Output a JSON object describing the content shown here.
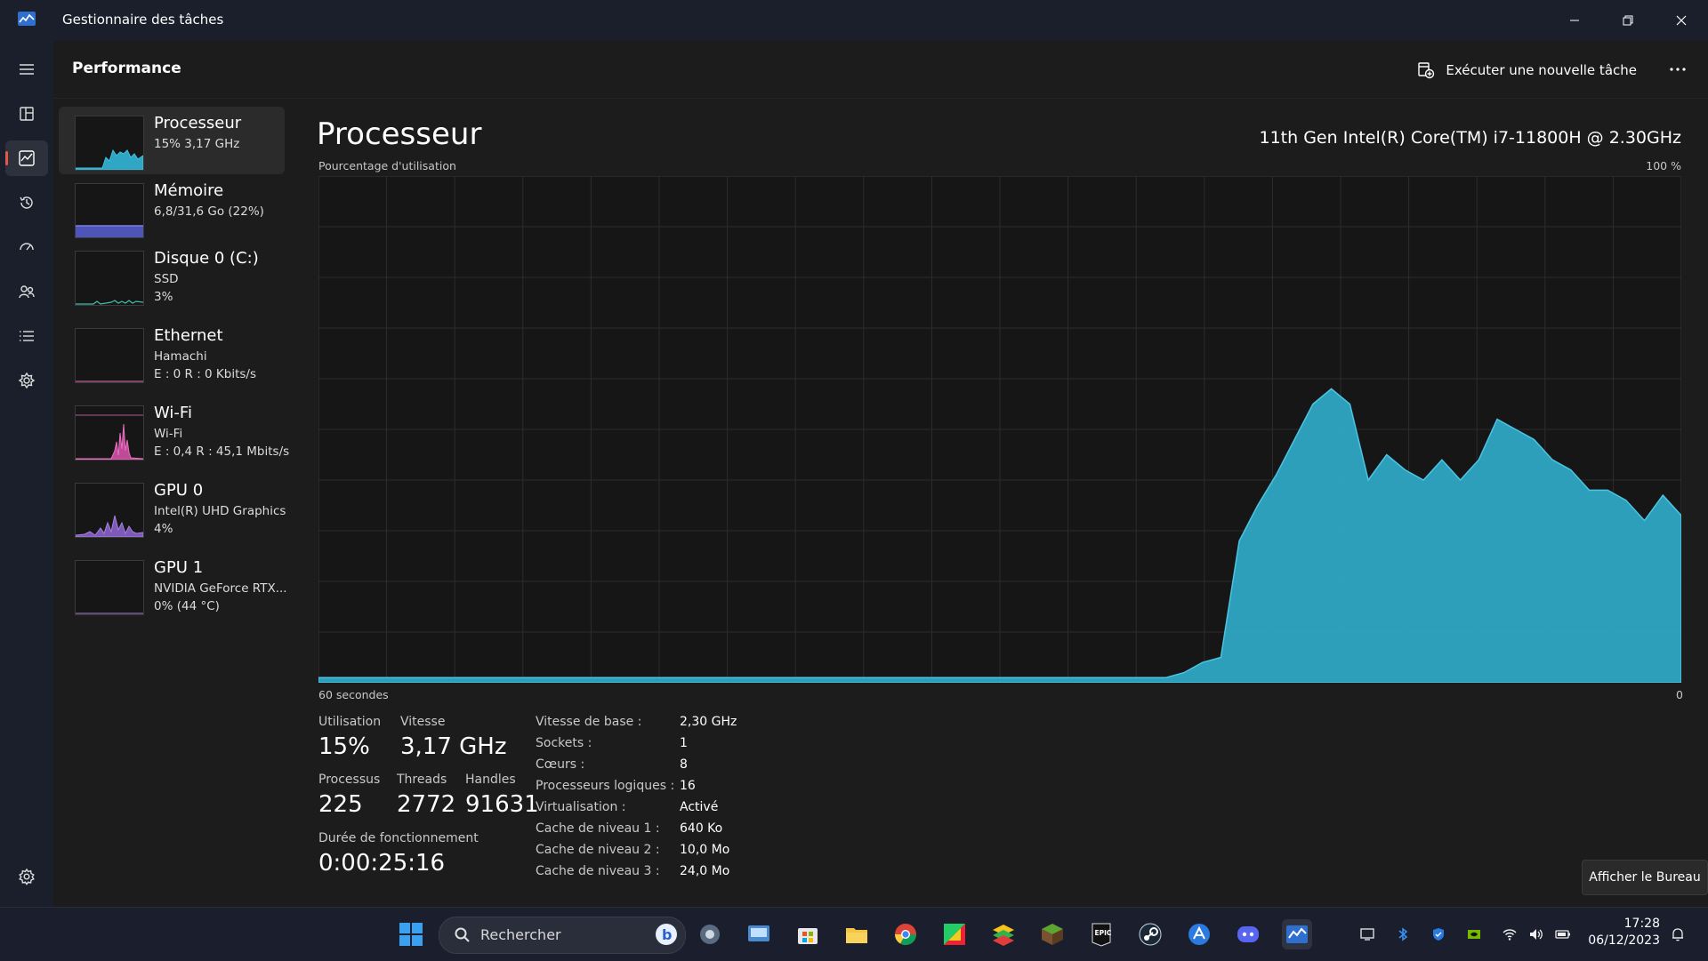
{
  "window": {
    "title": "Gestionnaire des tâches"
  },
  "header": {
    "title": "Performance",
    "run_task": "Exécuter une nouvelle tâche"
  },
  "sidebar": [
    {
      "name": "Processeur",
      "line1": "15% 3,17 GHz",
      "line2": ""
    },
    {
      "name": "Mémoire",
      "line1": "6,8/31,6 Go (22%)",
      "line2": ""
    },
    {
      "name": "Disque 0 (C:)",
      "line1": "SSD",
      "line2": "3%"
    },
    {
      "name": "Ethernet",
      "line1": "Hamachi",
      "line2": "E : 0 R : 0 Kbits/s"
    },
    {
      "name": "Wi-Fi",
      "line1": "Wi-Fi",
      "line2": "E : 0,4 R : 45,1 Mbits/s"
    },
    {
      "name": "GPU 0",
      "line1": "Intel(R) UHD Graphics",
      "line2": "4%"
    },
    {
      "name": "GPU 1",
      "line1": "NVIDIA GeForce RTX...",
      "line2": "0% (44 °C)"
    }
  ],
  "main": {
    "title": "Processeur",
    "model": "11th Gen Intel(R) Core(TM) i7-11800H @ 2.30GHz",
    "graph_label": "Pourcentage d'utilisation",
    "graph_max": "100 %",
    "graph_span": "60 secondes",
    "graph_min": "0"
  },
  "stats": {
    "utilisation_label": "Utilisation",
    "utilisation": "15%",
    "vitesse_label": "Vitesse",
    "vitesse": "3,17 GHz",
    "processus_label": "Processus",
    "processus": "225",
    "threads_label": "Threads",
    "threads": "2772",
    "handles_label": "Handles",
    "handles": "91631",
    "uptime_label": "Durée de fonctionnement",
    "uptime": "0:00:25:16"
  },
  "details": [
    {
      "key": "Vitesse de base :",
      "value": "2,30 GHz"
    },
    {
      "key": "Sockets :",
      "value": "1"
    },
    {
      "key": "Cœurs :",
      "value": "8"
    },
    {
      "key": "Processeurs logiques :",
      "value": "16"
    },
    {
      "key": "Virtualisation :",
      "value": "Activé"
    },
    {
      "key": "Cache de niveau 1 :",
      "value": "640 Ko"
    },
    {
      "key": "Cache de niveau 2 :",
      "value": "10,0 Mo"
    },
    {
      "key": "Cache de niveau 3 :",
      "value": "24,0 Mo"
    }
  ],
  "desktop_button": "Afficher le Bureau",
  "taskbar": {
    "search_placeholder": "Rechercher",
    "time": "17:28",
    "date": "06/12/2023"
  },
  "colors": {
    "accent": "#2ea6c4",
    "memory": "#7b7fe0",
    "wifi": "#e870c0",
    "gpu": "#a583e0",
    "indicator": "#e0584b"
  },
  "chart_data": {
    "type": "area",
    "x_range": [
      60,
      0
    ],
    "ylim": [
      0,
      100
    ],
    "values": [
      1,
      1,
      1,
      1,
      1,
      1,
      1,
      1,
      1,
      1,
      1,
      1,
      1,
      1,
      1,
      1,
      1,
      1,
      1,
      1,
      1,
      1,
      1,
      1,
      1,
      1,
      1,
      1,
      1,
      1,
      1,
      1,
      1,
      1,
      1,
      1,
      1,
      1,
      1,
      1,
      1,
      1,
      1,
      1,
      1,
      1,
      1,
      2,
      4,
      5,
      28,
      35,
      41,
      48,
      55,
      58,
      55,
      40,
      45,
      42,
      40,
      44,
      40,
      44,
      52,
      50,
      48,
      44,
      42,
      38,
      38,
      36,
      32,
      37,
      33
    ]
  }
}
